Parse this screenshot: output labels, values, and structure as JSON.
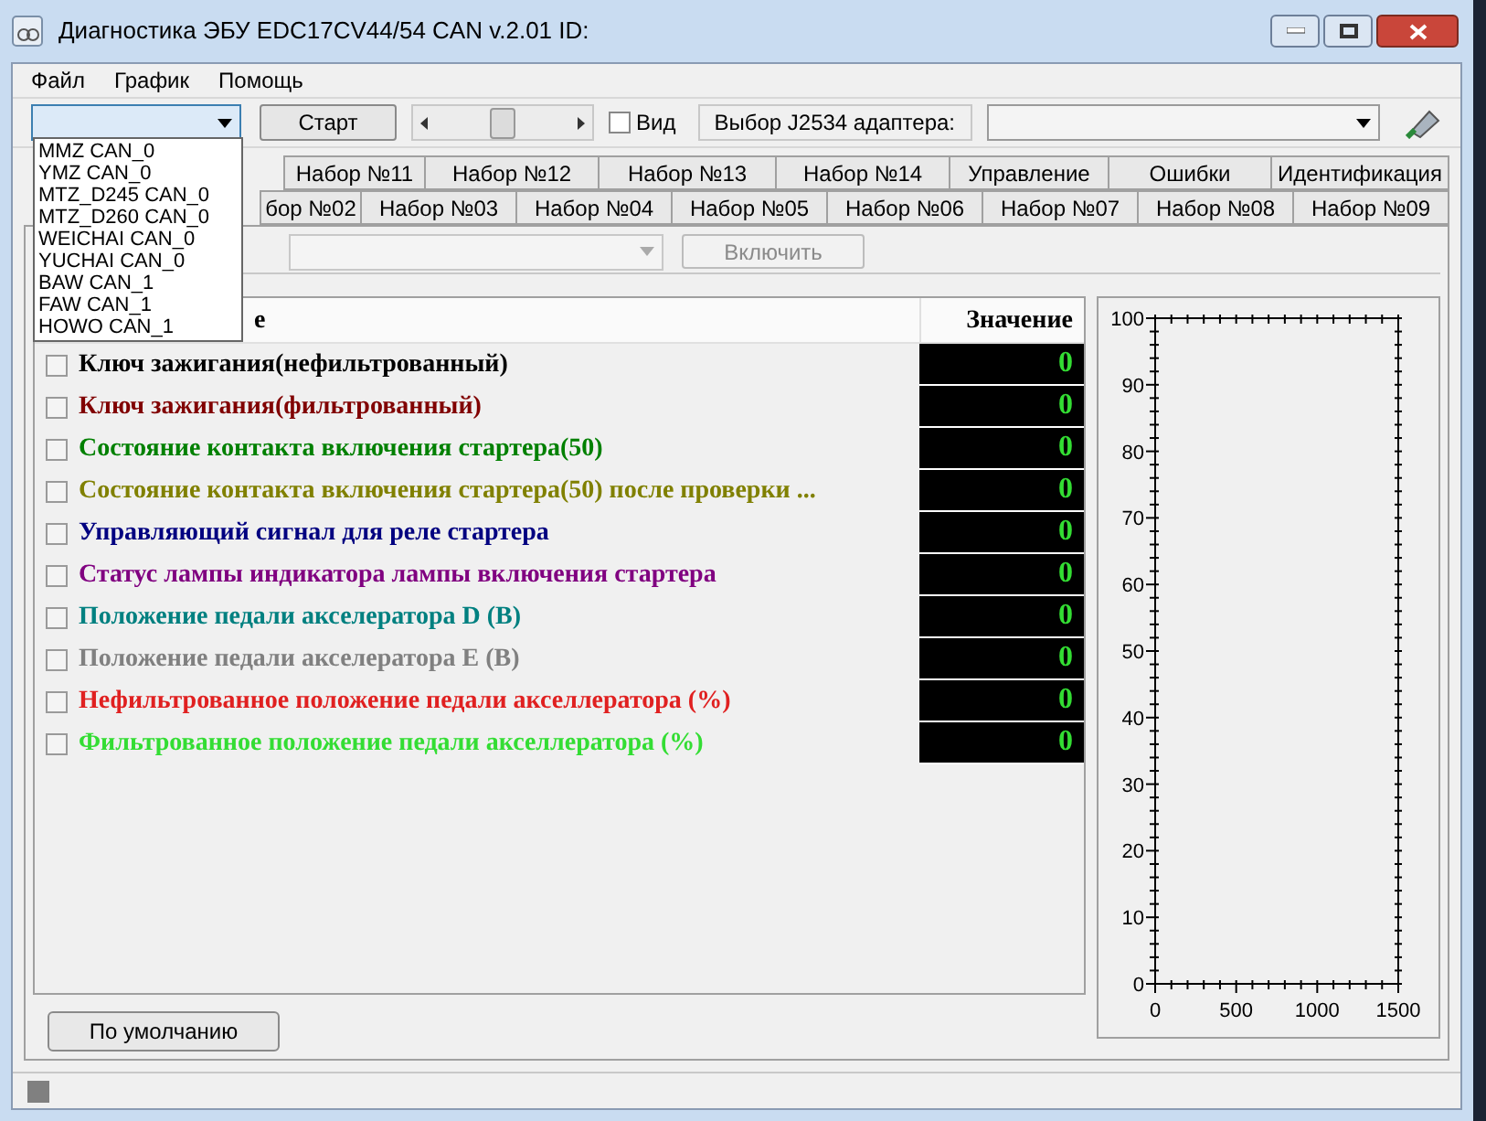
{
  "window": {
    "title": "Диагностика ЭБУ EDC17CV44/54 CAN v.2.01 ID:"
  },
  "menu": [
    "Файл",
    "График",
    "Помощь"
  ],
  "toolbar": {
    "start_button": "Старт",
    "view_checkbox": {
      "label": "Вид",
      "checked": false
    },
    "adapter_label": "Выбор J2534 адаптера:",
    "slider": {
      "level": 0.5
    }
  },
  "protocol_dropdown": {
    "expanded": true,
    "options": [
      "MMZ CAN_0",
      "YMZ CAN_0",
      "MTZ_D245 CAN_0",
      "MTZ_D260 CAN_0",
      "WEICHAI CAN_0",
      "YUCHAI CAN_0",
      "BAW CAN_1",
      "FAW CAN_1",
      "HOWO CAN_1"
    ]
  },
  "tabs_row_1": [
    {
      "label": "Набор №11",
      "selected": false
    },
    {
      "label": "Набор №12",
      "selected": false
    },
    {
      "label": "Набор №13",
      "selected": false
    },
    {
      "label": "Набор №14",
      "selected": false
    },
    {
      "label": "Управление",
      "selected": false
    },
    {
      "label": "Ошибки",
      "selected": false
    },
    {
      "label": "Идентификация",
      "selected": false
    }
  ],
  "tabs_row_2": [
    {
      "label": "бор №02",
      "selected": false
    },
    {
      "label": "Набор №03",
      "selected": false
    },
    {
      "label": "Набор №04",
      "selected": false
    },
    {
      "label": "Набор №05",
      "selected": false
    },
    {
      "label": "Набор №06",
      "selected": false
    },
    {
      "label": "Набор №07",
      "selected": false
    },
    {
      "label": "Набор №08",
      "selected": false
    },
    {
      "label": "Набор №09",
      "selected": false
    }
  ],
  "enable_button": {
    "label": "Включить",
    "disabled": true
  },
  "table": {
    "columns": [
      "е",
      "Значение"
    ],
    "rows": [
      {
        "name": "Ключ зажигания(нефильтрованный)",
        "value": "0",
        "checked": false,
        "color": "#000000"
      },
      {
        "name": "Ключ зажигания(фильтрованный)",
        "value": "0",
        "checked": false,
        "color": "#800000"
      },
      {
        "name": "Состояние контакта включения стартера(50)",
        "value": "0",
        "checked": false,
        "color": "#008000"
      },
      {
        "name": "Состояние контакта включения стартера(50) после проверки ...",
        "value": "0",
        "checked": false,
        "color": "#808000"
      },
      {
        "name": "Управляющий сигнал для реле стартера",
        "value": "0",
        "checked": false,
        "color": "#000080"
      },
      {
        "name": "Статус лампы индикатора лампы включения стартера",
        "value": "0",
        "checked": false,
        "color": "#800080"
      },
      {
        "name": "Положение педали акселератора D (B)",
        "value": "0",
        "checked": false,
        "color": "#008080"
      },
      {
        "name": "Положение педали акселератора E (B)",
        "value": "0",
        "checked": false,
        "color": "#808080"
      },
      {
        "name": "Нефильтрованное положение педали акселлератора (%)",
        "value": "0",
        "checked": false,
        "color": "#e02020"
      },
      {
        "name": "Фильтрованное положение педали акселлератора (%)",
        "value": "0",
        "checked": false,
        "color": "#33dd33"
      }
    ]
  },
  "chart": {
    "chart_data": {
      "type": "line",
      "xlim": [
        0,
        1500
      ],
      "ylim": [
        0,
        100
      ],
      "xticks": [
        0,
        500,
        1000,
        1500
      ],
      "yticks": [
        0,
        10,
        20,
        30,
        40,
        50,
        60,
        70,
        80,
        90,
        100
      ]
    }
  },
  "default_button": "По умолчанию"
}
